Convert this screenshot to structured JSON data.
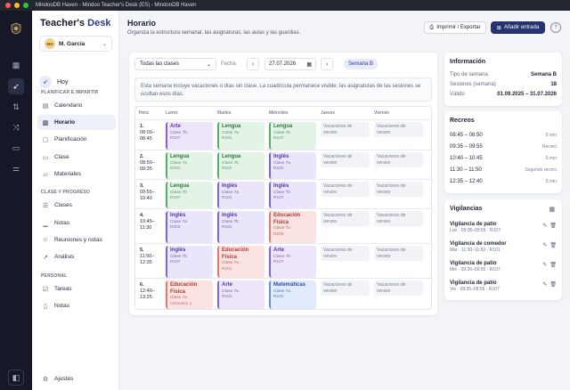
{
  "window": {
    "title": "MindooDB Haven - Mindoo Teacher's Desk (ES) - MindooDB Haven"
  },
  "brand": {
    "part1": "Teacher's ",
    "part2": "Desk"
  },
  "user": {
    "initials": "MG",
    "name": "M. García"
  },
  "sidebar": {
    "today": "Hoy",
    "sections": {
      "planning": "PLANIFICAR E IMPARTIR",
      "class": "CLASE Y PROGRESO",
      "personal": "PERSONAL"
    },
    "planning_items": [
      "Calendario",
      "Horario",
      "Planificación",
      "Clase",
      "Materiales"
    ],
    "class_items": [
      "Clases",
      "Notas",
      "Reuniones y notas",
      "Análisis"
    ],
    "personal_items": [
      "Tareas",
      "Notas"
    ],
    "settings": "Ajustes"
  },
  "header": {
    "title": "Horario",
    "subtitle": "Organiza la estructura semanal, las asignaturas, las aulas y las guardias.",
    "print_label": "Imprimir / Exportar",
    "add_label": "Añadir entrada",
    "help": "?"
  },
  "toolbar": {
    "class_filter": "Todas las clases",
    "date_label": "Fecha",
    "date_value": "27.07.2026",
    "week_badge": "Semana B"
  },
  "notice": "Esta semana incluye vacaciones o días sin clase. La cuadrícula permanece visible; las asignaturas de las sesiones se ocultan esos días.",
  "grid": {
    "headers": [
      "Hora",
      "Lunes",
      "Martes",
      "Miércoles",
      "Jueves",
      "Viernes"
    ],
    "periods": [
      {
        "num": "1.",
        "time": "08:00–\n08:45"
      },
      {
        "num": "2.",
        "time": "08:50–\n09:35"
      },
      {
        "num": "3.",
        "time": "09:55–\n10:40"
      },
      {
        "num": "4.",
        "time": "10:45–\n11:30"
      },
      {
        "num": "5.",
        "time": "11:50–\n12:35"
      },
      {
        "num": "6.",
        "time": "12:40–\n13:25"
      }
    ],
    "vacation_label": "Vacaciones de verano",
    "cells": [
      [
        {
          "subj": "Arte",
          "cls": "Clase 7b",
          "room": "R107",
          "kind": "arte"
        },
        {
          "subj": "Lengua",
          "cls": "Clase 7a",
          "room": "R101",
          "kind": "lengua"
        },
        {
          "subj": "Lengua",
          "cls": "Clase 7b",
          "room": "R107",
          "kind": "lengua"
        }
      ],
      [
        {
          "subj": "Lengua",
          "cls": "Clase 7a",
          "room": "R101",
          "kind": "lengua"
        },
        {
          "subj": "Lengua",
          "cls": "Clase 7b",
          "room": "R107",
          "kind": "lengua"
        },
        {
          "subj": "Inglés",
          "cls": "Clase 7a",
          "room": "R101",
          "kind": "ingles"
        }
      ],
      [
        {
          "subj": "Lengua",
          "cls": "Clase 7b",
          "room": "R107",
          "kind": "lengua"
        },
        {
          "subj": "Inglés",
          "cls": "Clase 7a",
          "room": "R101",
          "kind": "ingles"
        },
        {
          "subj": "Inglés",
          "cls": "Clase 7b",
          "room": "R107",
          "kind": "ingles"
        }
      ],
      [
        {
          "subj": "Inglés",
          "cls": "Clase 7a",
          "room": "R203",
          "kind": "ingles"
        },
        {
          "subj": "Inglés",
          "cls": "Clase 7b",
          "room": "R101",
          "kind": "ingles"
        },
        {
          "subj": "Educación Física",
          "cls": "Clase 7a",
          "room": "R203",
          "kind": "edf"
        }
      ],
      [
        {
          "subj": "Inglés",
          "cls": "Clase 7b",
          "room": "R107",
          "kind": "ingles"
        },
        {
          "subj": "Educación Física",
          "cls": "Clase 7a",
          "room": "R101",
          "kind": "edf"
        },
        {
          "subj": "Arte",
          "cls": "Clase 7b",
          "room": "R107",
          "kind": "arte"
        }
      ],
      [
        {
          "subj": "Educación Física",
          "cls": "Clase 7a",
          "room": "Gimnasio 1",
          "kind": "edf"
        },
        {
          "subj": "Arte",
          "cls": "Clase 7a",
          "room": "R101",
          "kind": "arte"
        },
        {
          "subj": "Matemáticas",
          "cls": "Clase 7a",
          "room": "R101",
          "kind": "mat"
        }
      ]
    ]
  },
  "info": {
    "title": "Información",
    "rows": [
      {
        "k": "Tipo de semana",
        "v": "Semana B"
      },
      {
        "k": "Sesiones (semana)",
        "v": "18"
      },
      {
        "k": "Válido",
        "v": "01.09.2025 – 31.07.2026"
      }
    ]
  },
  "recesses": {
    "title": "Recreos",
    "rows": [
      {
        "t": "08:45 – 08:50",
        "d": "5 min"
      },
      {
        "t": "09:35 – 09:55",
        "d": "Recreo"
      },
      {
        "t": "10:40 – 10:45",
        "d": "5 min"
      },
      {
        "t": "11:30 – 11:50",
        "d": "Segundo recreo"
      },
      {
        "t": "12:35 – 12:40",
        "d": "5 min"
      }
    ]
  },
  "duties": {
    "title": "Vigilancias",
    "rows": [
      {
        "t": "Vigilancia de patio",
        "s": "Lun · 09:35–09:55 · R107"
      },
      {
        "t": "Vigilancia de comedor",
        "s": "Mar · 11:30–11:50 · R101"
      },
      {
        "t": "Vigilancia de patio",
        "s": "Mié · 09:35–09:55 · R107"
      },
      {
        "t": "Vigilancia de patio",
        "s": "Vie · 09:35–09:55 · R107"
      }
    ]
  }
}
